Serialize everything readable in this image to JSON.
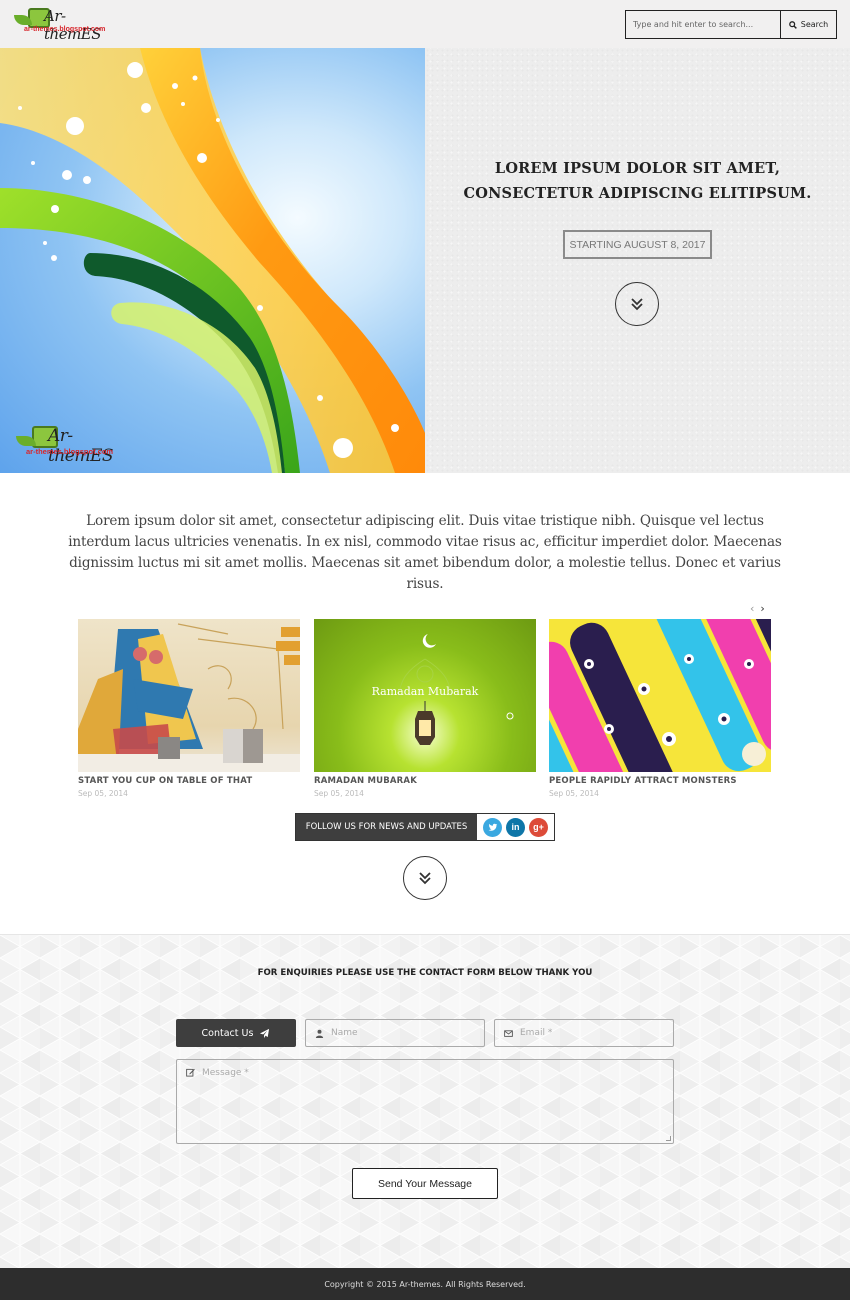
{
  "header": {
    "logo": {
      "text": "Ar-themES",
      "subtext": "ar-themes.blogspot.com"
    },
    "search": {
      "placeholder": "Type and hit enter to search...",
      "value": "",
      "button_label": "Search",
      "icon": "search-icon"
    }
  },
  "hero": {
    "image_watermark": {
      "text": "Ar-themES",
      "subtext": "ar-themes.blogspot.com"
    },
    "title_line1": "LOREM IPSUM DOLOR SIT AMET,",
    "title_line2": "CONSECTETUR ADIPISCING ELITIPSUM.",
    "date_badge": "STARTING AUGUST 8, 2017",
    "scroll_icon": "double-chevron-down-icon"
  },
  "intro": {
    "text": "Lorem ipsum dolor sit amet, consectetur adipiscing elit. Duis vitae tristique nibh. Quisque vel lectus interdum lacus ultricies venenatis. In ex nisl, commodo vitae risus ac, efficitur imperdiet dolor. Maecenas dignissim luctus mi sit amet mollis. Maecenas sit amet bibendum dolor, a molestie tellus. Donec et varius risus."
  },
  "carousel": {
    "prev_label": "‹",
    "next_label": "›",
    "posts": [
      {
        "title": "START YOU CUP ON TABLE OF THAT",
        "date": "Sep 05, 2014",
        "image": "cafe mural illustration"
      },
      {
        "title": "RAMADAN MUBARAK",
        "date": "Sep 05, 2014",
        "image": "green ramadan lantern",
        "image_caption": "Ramadan Mubarak"
      },
      {
        "title": "PEOPLE RAPIDLY ATTRACT MONSTERS",
        "date": "Sep 05, 2014",
        "image": "colorful monsters pattern"
      }
    ]
  },
  "follow": {
    "label": "FOLLOW US FOR NEWS AND UPDATES",
    "networks": [
      {
        "name": "twitter",
        "glyph": "t",
        "color": "#3aa8e0"
      },
      {
        "name": "linkedin",
        "glyph": "in",
        "color": "#0e76a8"
      },
      {
        "name": "google-plus",
        "glyph": "g+",
        "color": "#dd4b39"
      }
    ]
  },
  "contact": {
    "heading": "FOR ENQUIRIES PLEASE USE THE CONTACT FORM BELOW THANK YOU",
    "contact_button": "Contact Us",
    "name_placeholder": "Name",
    "email_placeholder": "Email *",
    "message_placeholder": "Message *",
    "send_button": "Send Your Message"
  },
  "footer": {
    "copyright": "Copyright © 2015 Ar-themes. All Rights Reserved."
  }
}
